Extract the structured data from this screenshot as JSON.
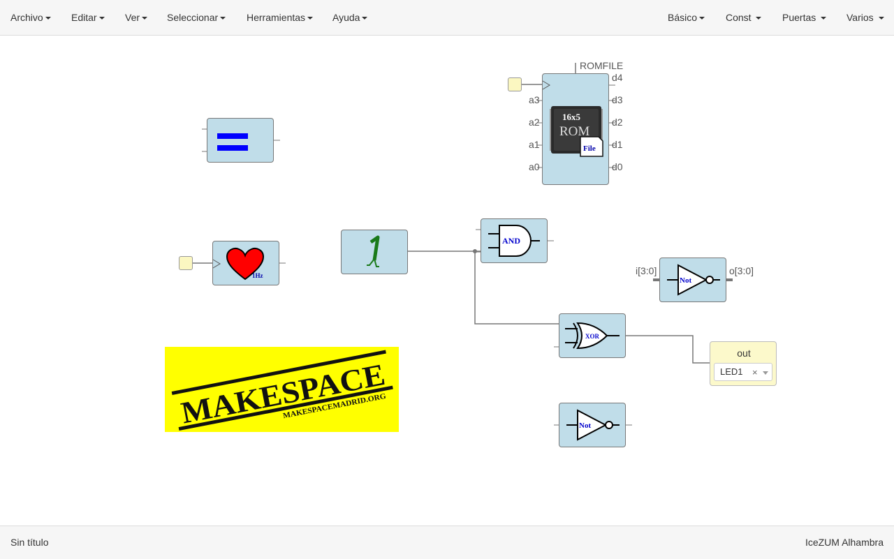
{
  "menubar": {
    "left": [
      "Archivo",
      "Editar",
      "Ver",
      "Seleccionar",
      "Herramientas",
      "Ayuda"
    ],
    "right": [
      "Básico",
      "Const",
      "Puertas",
      "Varios"
    ]
  },
  "rom": {
    "param_label": "ROMFILE",
    "inputs": [
      "a3",
      "a2",
      "a1",
      "a0"
    ],
    "outputs": [
      "d4",
      "d3",
      "d2",
      "d1",
      "d0"
    ],
    "chip_size": "16x5",
    "chip_title": "ROM",
    "file_label": "File"
  },
  "gates": {
    "and_label": "AND",
    "xor_label": "XOR",
    "not_bus_label": "Not",
    "not_label": "Not"
  },
  "not_bus": {
    "input": "i[3:0]",
    "output": "o[3:0]"
  },
  "heart": {
    "freq": "1Hz"
  },
  "logo_text": "MAKESPACE MAKESPACEMADRID.ORG",
  "output_pin": {
    "label": "out",
    "value": "LED1",
    "clear": "×"
  },
  "footer": {
    "filename": "Sin título",
    "board": "IceZUM Alhambra"
  },
  "colors": {
    "block_fill": "#c0dde9",
    "logo_bg": "#ffff00",
    "equal_sign": "#0000ff",
    "heart": "#ff0000",
    "const_one": "#1a7a1a"
  }
}
